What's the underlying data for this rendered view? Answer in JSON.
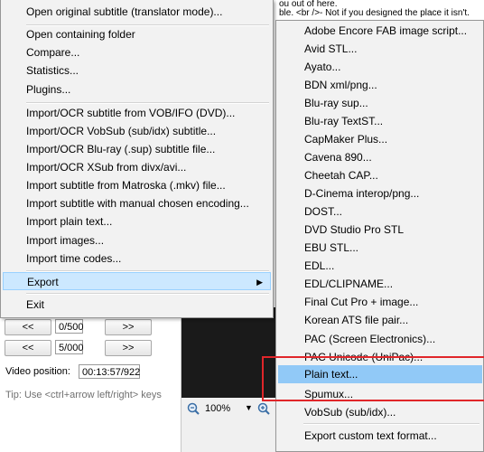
{
  "background_text": {
    "line1": "ou out of here.",
    "line2": "ble. <br />- Not if you designed the place it isn't."
  },
  "main_menu": {
    "items": [
      {
        "label": "Open original subtitle (translator mode)..."
      },
      {
        "label": "Open containing folder"
      },
      {
        "label": "Compare..."
      },
      {
        "label": "Statistics..."
      },
      {
        "label": "Plugins..."
      },
      {
        "label": "Import/OCR subtitle from VOB/IFO (DVD)..."
      },
      {
        "label": "Import/OCR VobSub (sub/idx) subtitle..."
      },
      {
        "label": "Import/OCR Blu-ray (.sup) subtitle file..."
      },
      {
        "label": "Import/OCR XSub from divx/avi..."
      },
      {
        "label": "Import subtitle from Matroska (.mkv) file..."
      },
      {
        "label": "Import subtitle with manual chosen encoding..."
      },
      {
        "label": "Import plain text..."
      },
      {
        "label": "Import images..."
      },
      {
        "label": "Import time codes..."
      },
      {
        "label": "Export"
      },
      {
        "label": "Exit"
      }
    ],
    "submenu_arrow": "▶"
  },
  "export_submenu": {
    "items": [
      {
        "label": "Adobe Encore FAB image script..."
      },
      {
        "label": "Avid STL..."
      },
      {
        "label": "Ayato..."
      },
      {
        "label": "BDN xml/png..."
      },
      {
        "label": "Blu-ray sup..."
      },
      {
        "label": "Blu-ray TextST..."
      },
      {
        "label": "CapMaker Plus..."
      },
      {
        "label": "Cavena 890..."
      },
      {
        "label": "Cheetah CAP..."
      },
      {
        "label": "D-Cinema interop/png..."
      },
      {
        "label": "DOST..."
      },
      {
        "label": "DVD Studio Pro STL"
      },
      {
        "label": "EBU STL..."
      },
      {
        "label": "EDL..."
      },
      {
        "label": "EDL/CLIPNAME..."
      },
      {
        "label": "Final Cut Pro + image..."
      },
      {
        "label": "Korean ATS file pair..."
      },
      {
        "label": "PAC (Screen Electronics)..."
      },
      {
        "label": "PAC Unicode (UniPac)..."
      },
      {
        "label": "Plain text..."
      },
      {
        "label": "Spumux..."
      },
      {
        "label": "VobSub (sub/idx)..."
      },
      {
        "label": "Export custom text format..."
      }
    ]
  },
  "nav_panel": {
    "prev_label": "<<",
    "next_label": ">>",
    "field1_value": "0/500",
    "field2_value": "5/000",
    "video_position_label": "Video position:",
    "video_position_value": "00:13:57/922",
    "tip": "Tip: Use <ctrl+arrow left/right> keys"
  },
  "zoom": {
    "value": "100%"
  },
  "colors": {
    "highlight_main": "#cce8ff",
    "highlight_sub": "#91c9f7",
    "annotation_box": "#e0262a"
  }
}
